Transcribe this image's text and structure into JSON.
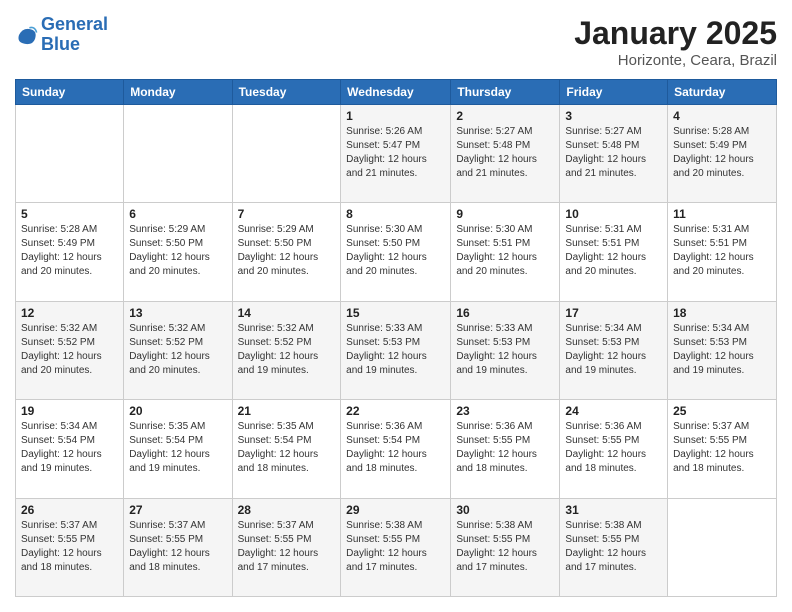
{
  "logo": {
    "line1": "General",
    "line2": "Blue"
  },
  "header": {
    "title": "January 2025",
    "subtitle": "Horizonte, Ceara, Brazil"
  },
  "weekdays": [
    "Sunday",
    "Monday",
    "Tuesday",
    "Wednesday",
    "Thursday",
    "Friday",
    "Saturday"
  ],
  "weeks": [
    [
      {
        "day": "",
        "info": ""
      },
      {
        "day": "",
        "info": ""
      },
      {
        "day": "",
        "info": ""
      },
      {
        "day": "1",
        "info": "Sunrise: 5:26 AM\nSunset: 5:47 PM\nDaylight: 12 hours\nand 21 minutes."
      },
      {
        "day": "2",
        "info": "Sunrise: 5:27 AM\nSunset: 5:48 PM\nDaylight: 12 hours\nand 21 minutes."
      },
      {
        "day": "3",
        "info": "Sunrise: 5:27 AM\nSunset: 5:48 PM\nDaylight: 12 hours\nand 21 minutes."
      },
      {
        "day": "4",
        "info": "Sunrise: 5:28 AM\nSunset: 5:49 PM\nDaylight: 12 hours\nand 20 minutes."
      }
    ],
    [
      {
        "day": "5",
        "info": "Sunrise: 5:28 AM\nSunset: 5:49 PM\nDaylight: 12 hours\nand 20 minutes."
      },
      {
        "day": "6",
        "info": "Sunrise: 5:29 AM\nSunset: 5:50 PM\nDaylight: 12 hours\nand 20 minutes."
      },
      {
        "day": "7",
        "info": "Sunrise: 5:29 AM\nSunset: 5:50 PM\nDaylight: 12 hours\nand 20 minutes."
      },
      {
        "day": "8",
        "info": "Sunrise: 5:30 AM\nSunset: 5:50 PM\nDaylight: 12 hours\nand 20 minutes."
      },
      {
        "day": "9",
        "info": "Sunrise: 5:30 AM\nSunset: 5:51 PM\nDaylight: 12 hours\nand 20 minutes."
      },
      {
        "day": "10",
        "info": "Sunrise: 5:31 AM\nSunset: 5:51 PM\nDaylight: 12 hours\nand 20 minutes."
      },
      {
        "day": "11",
        "info": "Sunrise: 5:31 AM\nSunset: 5:51 PM\nDaylight: 12 hours\nand 20 minutes."
      }
    ],
    [
      {
        "day": "12",
        "info": "Sunrise: 5:32 AM\nSunset: 5:52 PM\nDaylight: 12 hours\nand 20 minutes."
      },
      {
        "day": "13",
        "info": "Sunrise: 5:32 AM\nSunset: 5:52 PM\nDaylight: 12 hours\nand 20 minutes."
      },
      {
        "day": "14",
        "info": "Sunrise: 5:32 AM\nSunset: 5:52 PM\nDaylight: 12 hours\nand 19 minutes."
      },
      {
        "day": "15",
        "info": "Sunrise: 5:33 AM\nSunset: 5:53 PM\nDaylight: 12 hours\nand 19 minutes."
      },
      {
        "day": "16",
        "info": "Sunrise: 5:33 AM\nSunset: 5:53 PM\nDaylight: 12 hours\nand 19 minutes."
      },
      {
        "day": "17",
        "info": "Sunrise: 5:34 AM\nSunset: 5:53 PM\nDaylight: 12 hours\nand 19 minutes."
      },
      {
        "day": "18",
        "info": "Sunrise: 5:34 AM\nSunset: 5:53 PM\nDaylight: 12 hours\nand 19 minutes."
      }
    ],
    [
      {
        "day": "19",
        "info": "Sunrise: 5:34 AM\nSunset: 5:54 PM\nDaylight: 12 hours\nand 19 minutes."
      },
      {
        "day": "20",
        "info": "Sunrise: 5:35 AM\nSunset: 5:54 PM\nDaylight: 12 hours\nand 19 minutes."
      },
      {
        "day": "21",
        "info": "Sunrise: 5:35 AM\nSunset: 5:54 PM\nDaylight: 12 hours\nand 18 minutes."
      },
      {
        "day": "22",
        "info": "Sunrise: 5:36 AM\nSunset: 5:54 PM\nDaylight: 12 hours\nand 18 minutes."
      },
      {
        "day": "23",
        "info": "Sunrise: 5:36 AM\nSunset: 5:55 PM\nDaylight: 12 hours\nand 18 minutes."
      },
      {
        "day": "24",
        "info": "Sunrise: 5:36 AM\nSunset: 5:55 PM\nDaylight: 12 hours\nand 18 minutes."
      },
      {
        "day": "25",
        "info": "Sunrise: 5:37 AM\nSunset: 5:55 PM\nDaylight: 12 hours\nand 18 minutes."
      }
    ],
    [
      {
        "day": "26",
        "info": "Sunrise: 5:37 AM\nSunset: 5:55 PM\nDaylight: 12 hours\nand 18 minutes."
      },
      {
        "day": "27",
        "info": "Sunrise: 5:37 AM\nSunset: 5:55 PM\nDaylight: 12 hours\nand 18 minutes."
      },
      {
        "day": "28",
        "info": "Sunrise: 5:37 AM\nSunset: 5:55 PM\nDaylight: 12 hours\nand 17 minutes."
      },
      {
        "day": "29",
        "info": "Sunrise: 5:38 AM\nSunset: 5:55 PM\nDaylight: 12 hours\nand 17 minutes."
      },
      {
        "day": "30",
        "info": "Sunrise: 5:38 AM\nSunset: 5:55 PM\nDaylight: 12 hours\nand 17 minutes."
      },
      {
        "day": "31",
        "info": "Sunrise: 5:38 AM\nSunset: 5:55 PM\nDaylight: 12 hours\nand 17 minutes."
      },
      {
        "day": "",
        "info": ""
      }
    ]
  ]
}
